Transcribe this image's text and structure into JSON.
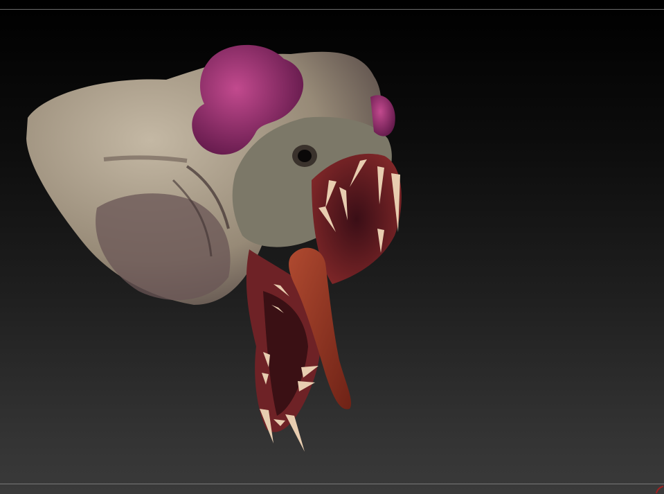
{
  "app": {
    "name": ""
  },
  "viewport": {
    "background_top": "#000000",
    "background_bottom": "#3a3a3a",
    "frame_line_color": "#6b6b6b"
  },
  "model": {
    "subject": "creature-head-sculpt",
    "colors": {
      "skin": "#a79a86",
      "skin_dark": "#5b4a4c",
      "flesh": "#8b2a2c",
      "tongue": "#9a3a24",
      "crest": "#8a2a6e",
      "teeth": "#e8cdb0"
    }
  },
  "corner": {
    "icon": "corner-indicator-icon",
    "color": "#a02020"
  }
}
